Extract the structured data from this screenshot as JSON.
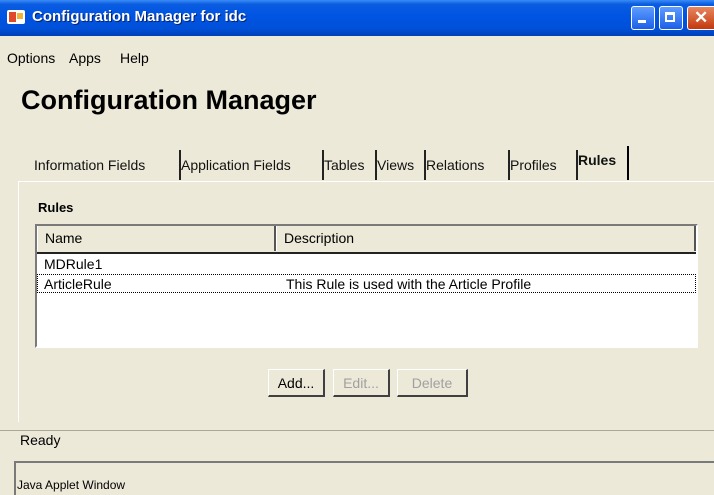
{
  "window": {
    "title": "Configuration Manager for idc",
    "controls": {
      "minimize": "minimize-icon",
      "maximize": "maximize-icon",
      "close": "close-icon"
    }
  },
  "menu": {
    "items": [
      "Options",
      "Apps",
      "Help"
    ]
  },
  "page": {
    "heading": "Configuration Manager"
  },
  "tabs": {
    "items": [
      "Information Fields",
      "Application Fields",
      "Tables",
      "Views",
      "Relations",
      "Profiles",
      "Rules"
    ],
    "selected": "Rules"
  },
  "rules": {
    "label": "Rules",
    "columns": [
      "Name",
      "Description"
    ],
    "rows": [
      {
        "name": "MDRule1",
        "description": ""
      },
      {
        "name": "ArticleRule",
        "description": "This Rule is used with the Article Profile"
      }
    ],
    "selected_row": "ArticleRule"
  },
  "buttons": {
    "add": "Add...",
    "edit": "Edit...",
    "delete": "Delete"
  },
  "status": {
    "text": "Ready"
  },
  "applet": {
    "text": "Java Applet Window"
  }
}
